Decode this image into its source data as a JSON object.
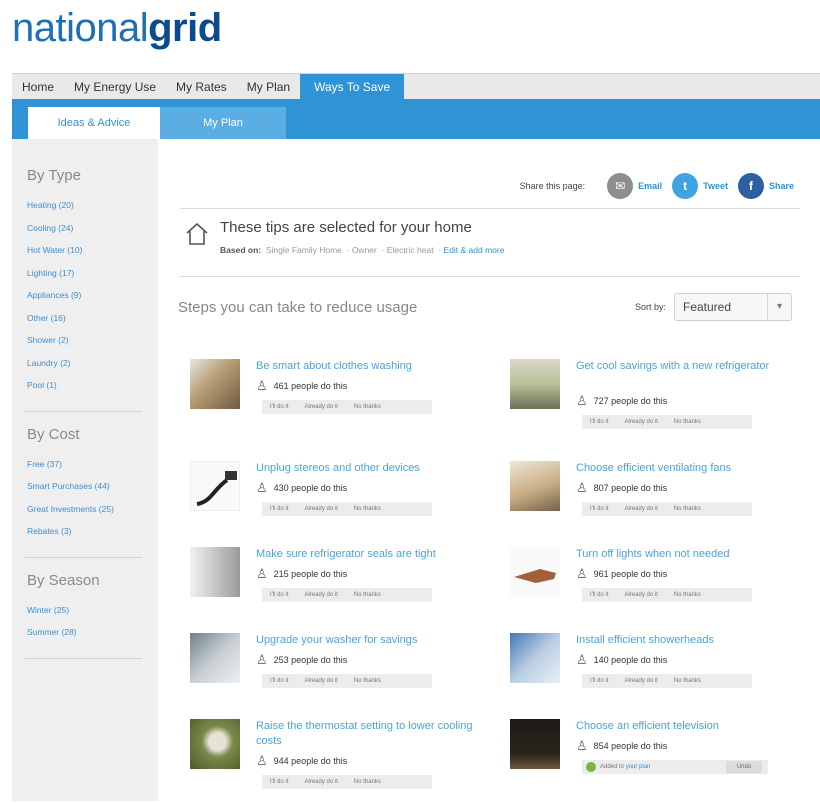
{
  "brand": {
    "part1": "national",
    "part2": "grid"
  },
  "top_nav": {
    "tabs": [
      "Home",
      "My Energy Use",
      "My Rates",
      "My Plan",
      "Ways To Save"
    ]
  },
  "sub_nav": {
    "tabs": [
      "Ideas & Advice",
      "My Plan"
    ]
  },
  "sidebar": {
    "by_type": {
      "heading": "By Type",
      "items": [
        "Heating (20)",
        "Cooling (24)",
        "Hot Water (10)",
        "Lighting (17)",
        "Appliances (9)",
        "Other (16)",
        "Shower (2)",
        "Laundry (2)",
        "Pool (1)"
      ]
    },
    "by_cost": {
      "heading": "By Cost",
      "items": [
        "Free (37)",
        "Smart Purchases (44)",
        "Great Investments (25)",
        "Rebates (3)"
      ]
    },
    "by_season": {
      "heading": "By Season",
      "items": [
        "Winter (25)",
        "Summer (28)"
      ]
    }
  },
  "share": {
    "label": "Share this page:",
    "email": "Email",
    "tweet": "Tweet",
    "share": "Share"
  },
  "home_tips": {
    "title": "These tips are selected for your home",
    "based_label": "Based on:",
    "tags": [
      "Single Family Home",
      "Owner",
      "Electric heat"
    ],
    "edit_link": "Edit & add more"
  },
  "steps": {
    "title": "Steps you can take to reduce usage",
    "sort_label": "Sort by:",
    "sort_value": "Featured"
  },
  "tip_buttons": [
    "I'll do it",
    "Already do it",
    "No thanks"
  ],
  "tips": [
    {
      "title": "Be smart about clothes washing",
      "people": "461 people do this"
    },
    {
      "title": "Get cool savings with a new refrigerator",
      "people": "727 people do this"
    },
    {
      "title": "Unplug stereos and other devices",
      "people": "430 people do this"
    },
    {
      "title": "Choose efficient ventilating fans",
      "people": "807 people do this"
    },
    {
      "title": "Make sure refrigerator seals are tight",
      "people": "215 people do this"
    },
    {
      "title": "Turn off lights when not needed",
      "people": "961 people do this"
    },
    {
      "title": "Upgrade your washer for savings",
      "people": "253 people do this"
    },
    {
      "title": "Install efficient showerheads",
      "people": "140 people do this"
    },
    {
      "title": "Raise the thermostat setting to lower cooling costs",
      "people": "944 people do this"
    },
    {
      "title": "Choose an efficient television",
      "people": "854 people do this"
    }
  ],
  "added_plan": {
    "text": "Added to",
    "link": "your plan",
    "undo": "Undo"
  }
}
